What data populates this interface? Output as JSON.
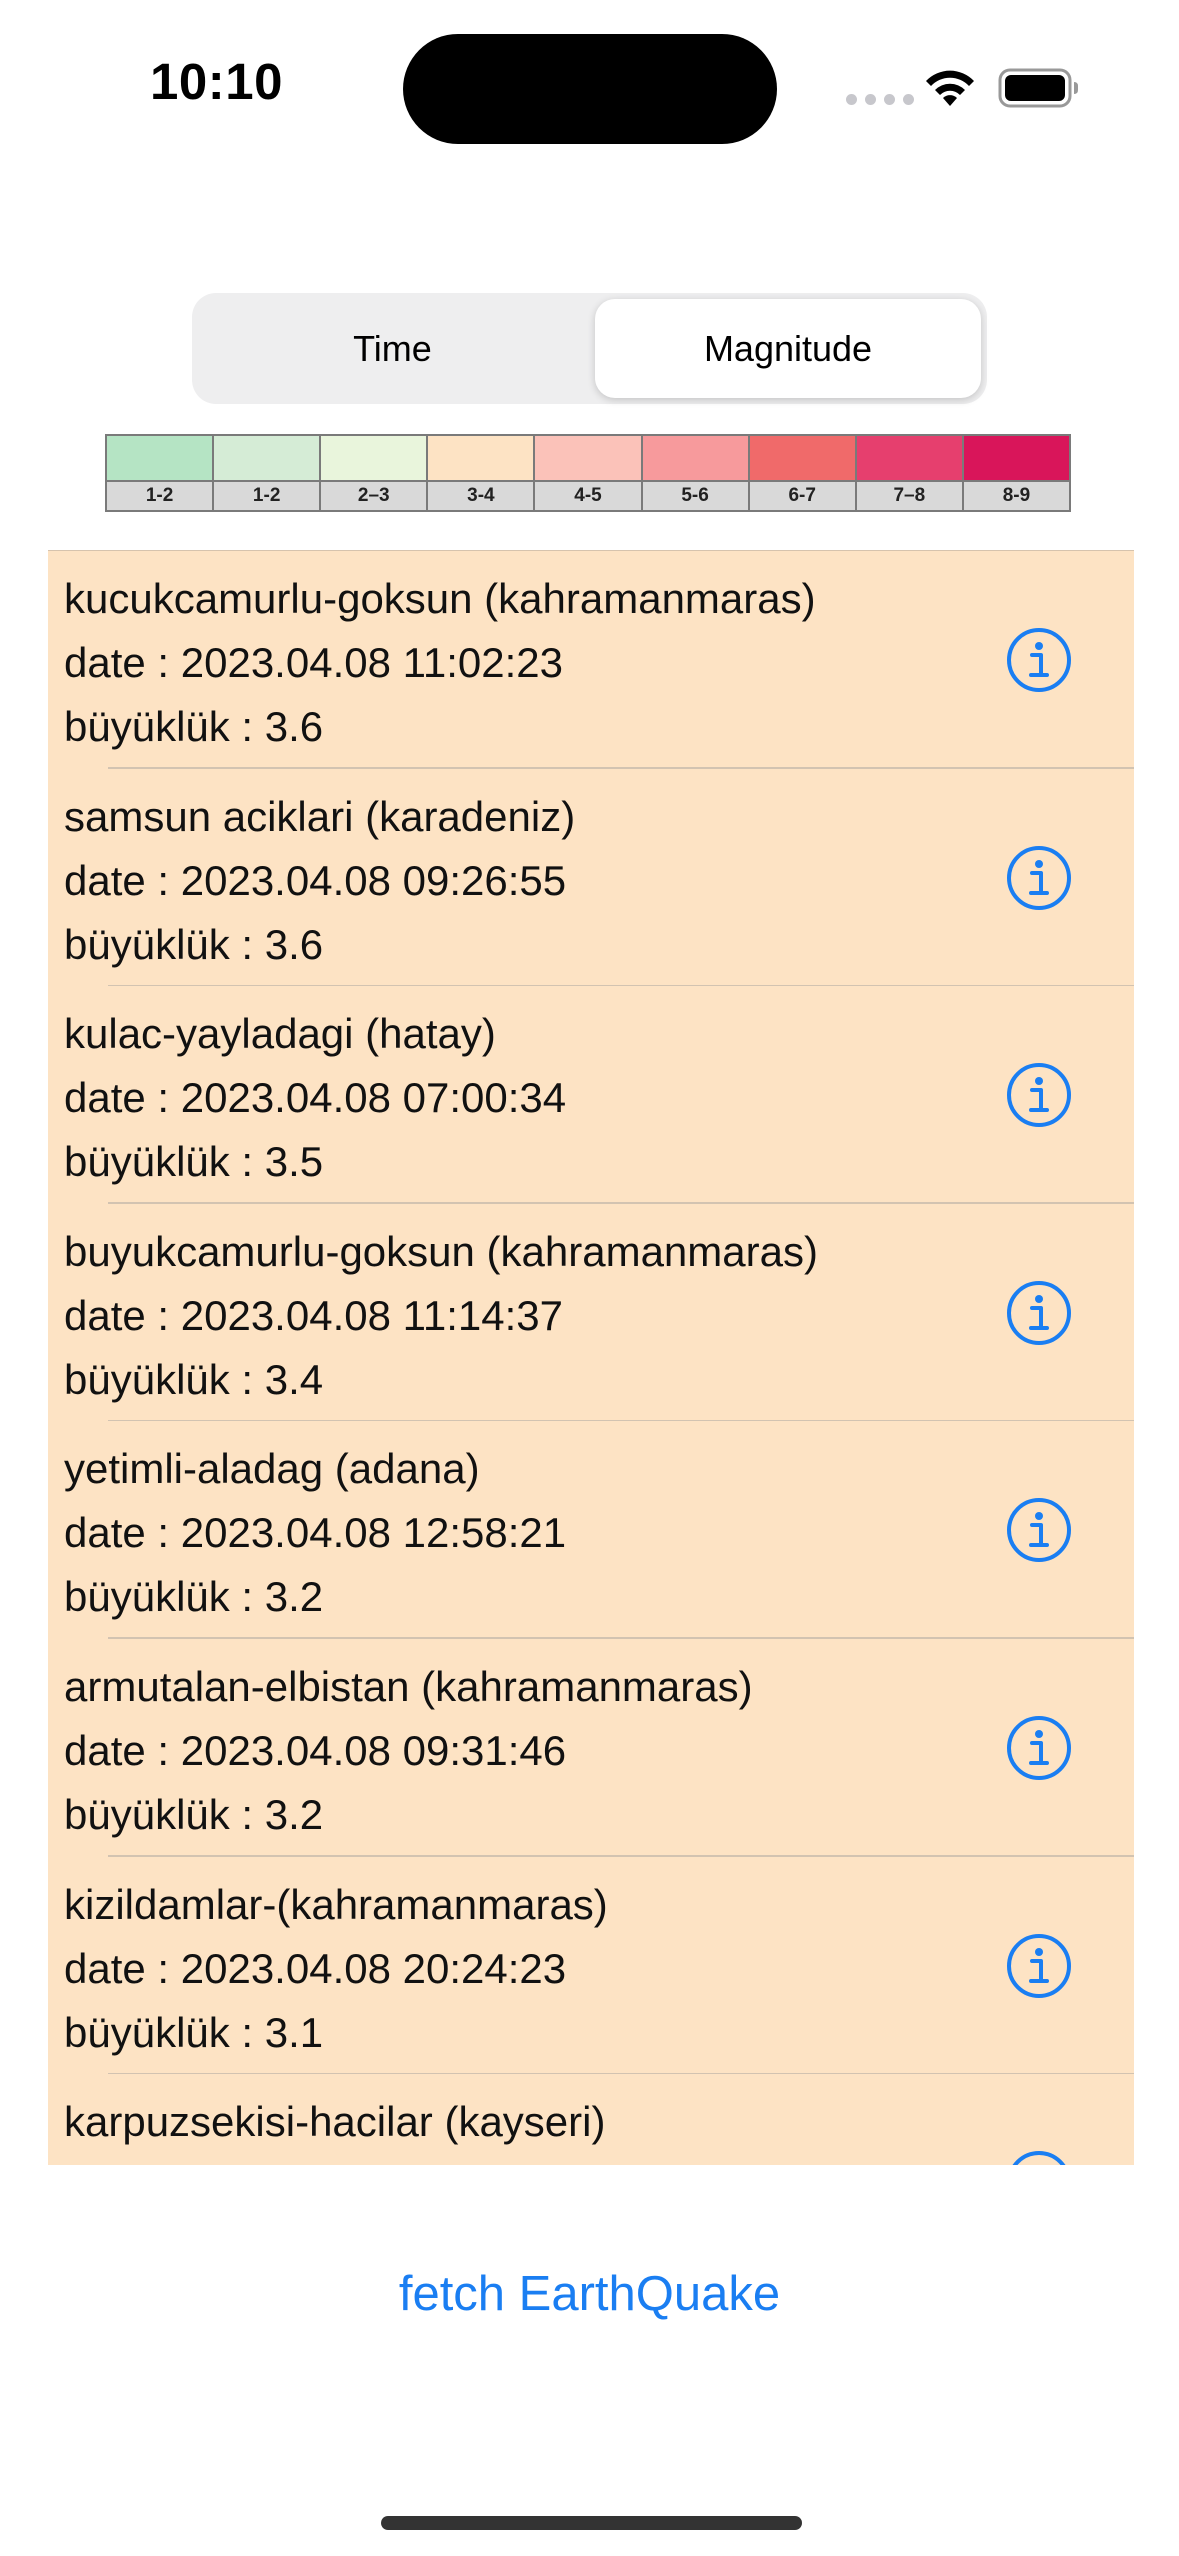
{
  "status_bar": {
    "time": "10:10"
  },
  "segmented": {
    "options": [
      "Time",
      "Magnitude"
    ],
    "selected": "Magnitude"
  },
  "legend": [
    {
      "label": "1-2",
      "color": "#b5e4c4"
    },
    {
      "label": "1-2",
      "color": "#d5ecd6"
    },
    {
      "label": "2–3",
      "color": "#e9f5dc"
    },
    {
      "label": "3-4",
      "color": "#fde3c4"
    },
    {
      "label": "4-5",
      "color": "#fbc2b9"
    },
    {
      "label": "5-6",
      "color": "#f79a9c"
    },
    {
      "label": "6-7",
      "color": "#f06a6a"
    },
    {
      "label": "7–8",
      "color": "#e63f6e"
    },
    {
      "label": "8-9",
      "color": "#d9155a"
    }
  ],
  "list_background": "#fde3c4",
  "earthquakes": [
    {
      "place": "kucukcamurlu-goksun (kahramanmaras)",
      "date": "date : 2023.04.08 11:02:23",
      "magnitude": "büyüklük : 3.6"
    },
    {
      "place": "samsun aciklari (karadeniz)",
      "date": "date : 2023.04.08 09:26:55",
      "magnitude": "büyüklük : 3.6"
    },
    {
      "place": "kulac-yayladagi (hatay)",
      "date": "date : 2023.04.08 07:00:34",
      "magnitude": "büyüklük : 3.5"
    },
    {
      "place": "buyukcamurlu-goksun (kahramanmaras)",
      "date": "date : 2023.04.08 11:14:37",
      "magnitude": "büyüklük : 3.4"
    },
    {
      "place": "yetimli-aladag (adana)",
      "date": "date : 2023.04.08 12:58:21",
      "magnitude": "büyüklük : 3.2"
    },
    {
      "place": "armutalan-elbistan (kahramanmaras)",
      "date": "date : 2023.04.08 09:31:46",
      "magnitude": "büyüklük : 3.2"
    },
    {
      "place": "kizildamlar-(kahramanmaras)",
      "date": "date : 2023.04.08 20:24:23",
      "magnitude": "büyüklük : 3.1"
    },
    {
      "place": "karpuzsekisi-hacilar (kayseri)",
      "date": "",
      "magnitude": ""
    }
  ],
  "fetch_button": {
    "label": "fetch EarthQuake"
  },
  "accent_color": "#1a7ef2"
}
